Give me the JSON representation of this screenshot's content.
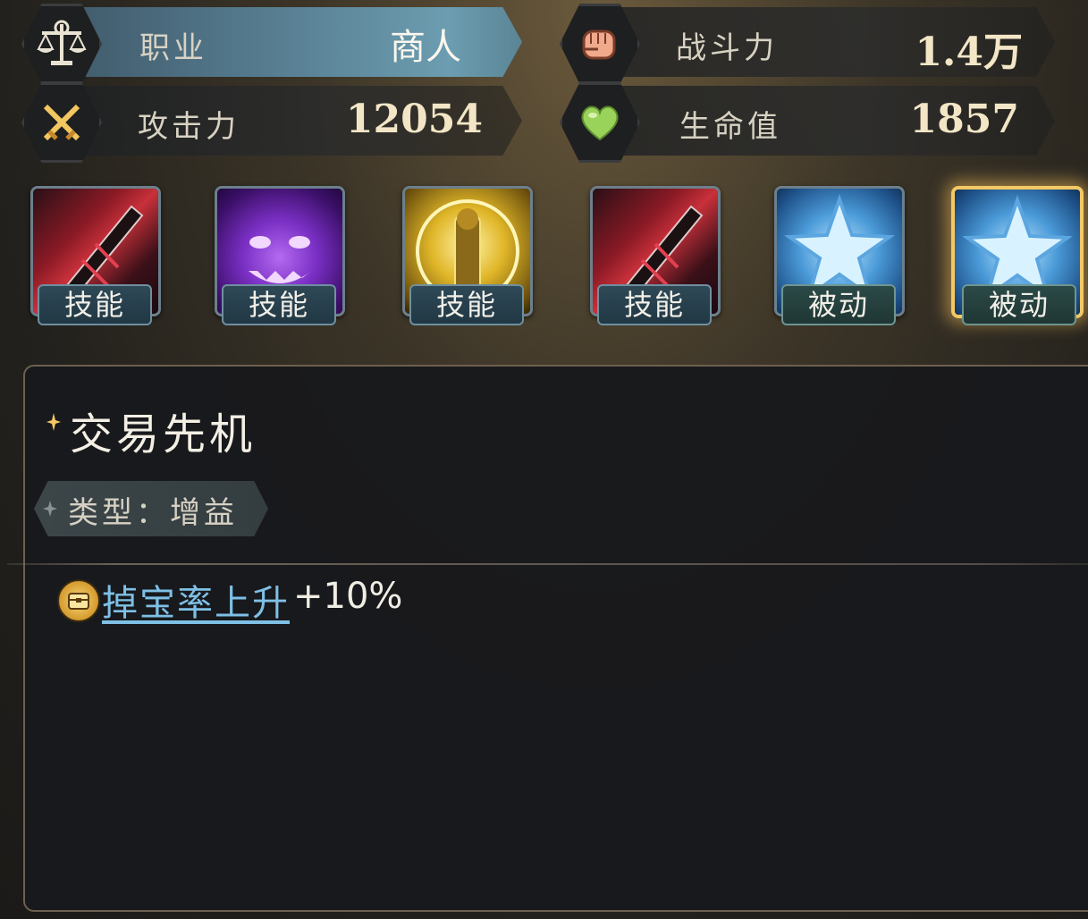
{
  "stats": {
    "job": {
      "label": "职业",
      "value": "商人",
      "icon": "scales-icon"
    },
    "power": {
      "label": "战斗力",
      "value": "1.4万",
      "icon": "fist-icon"
    },
    "attack": {
      "label": "攻击力",
      "value": "12054",
      "icon": "crossed-swords-icon"
    },
    "hp": {
      "label": "生命值",
      "value": "1857",
      "icon": "heart-icon"
    }
  },
  "skills": [
    {
      "tag": "技能",
      "art": "red-sword-skill",
      "kind": "skill"
    },
    {
      "tag": "技能",
      "art": "purple-demon-skill",
      "kind": "skill"
    },
    {
      "tag": "技能",
      "art": "golden-knight-skill",
      "kind": "skill"
    },
    {
      "tag": "技能",
      "art": "red-sword-skill",
      "kind": "skill"
    },
    {
      "tag": "被动",
      "art": "blue-star-passive",
      "kind": "passive"
    },
    {
      "tag": "被动",
      "art": "blue-star-passive",
      "kind": "passive",
      "selected": true
    }
  ],
  "detail": {
    "title": "交易先机",
    "type_label": "类型：增益",
    "effect": {
      "name": "掉宝率上升",
      "value": "+10%",
      "icon": "treasure-chest-icon"
    }
  },
  "colors": {
    "accent_gold": "#f3c865",
    "link_blue": "#7ec0e6",
    "job_highlight": "#557a8e"
  }
}
